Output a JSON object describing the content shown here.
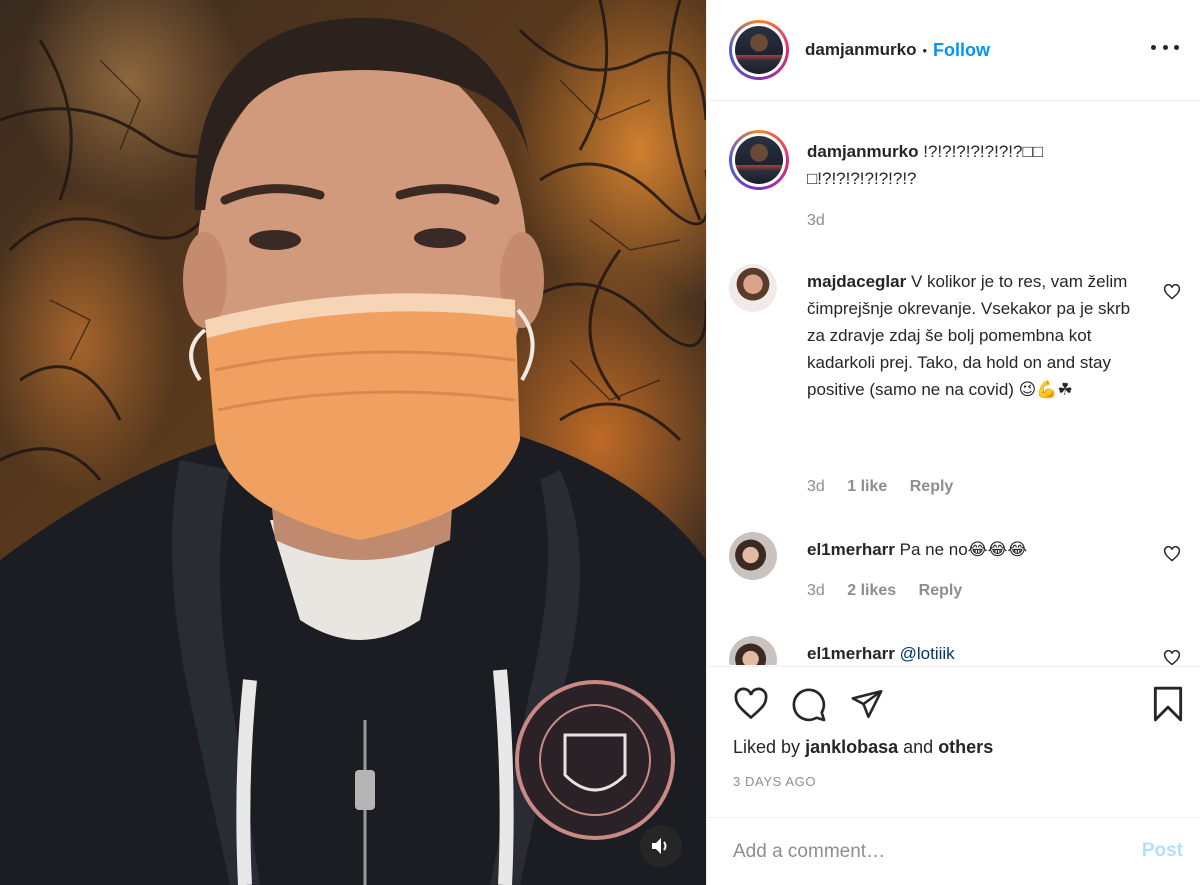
{
  "post": {
    "author": "damjanmurko",
    "follow_label": "Follow",
    "separator": "•",
    "caption": "!?!?!?!?!?!?!?□□ □!?!?!?!?!?!?!?",
    "caption_time": "3d"
  },
  "comments": [
    {
      "user": "majdaceglar",
      "text": "V kolikor je to res, vam želim čimprejšnje okrevanje. Vsekakor pa je skrb za zdravje zdaj še bolj pomembna kot kadarkoli prej. Tako, da hold on and stay positive (samo ne na covid) 😉💪☘",
      "time": "3d",
      "likes": "1 like",
      "reply_label": "Reply"
    },
    {
      "user": "el1merharr",
      "text": "Pa ne no😂😂😂",
      "time": "3d",
      "likes": "2 likes",
      "reply_label": "Reply"
    },
    {
      "user": "el1merharr",
      "mention": "@lotiiik"
    }
  ],
  "engagement": {
    "liked_prefix": "Liked by",
    "liked_user": "janklobasa",
    "liked_and": "and",
    "liked_others": "others",
    "date": "3 DAYS AGO"
  },
  "composer": {
    "placeholder": "Add a comment…",
    "post_label": "Post"
  },
  "icons": [
    "more-options-icon",
    "heart-icon",
    "comment-icon",
    "share-icon",
    "save-icon",
    "sound-icon"
  ],
  "colors": {
    "link": "#0095f6",
    "muted": "#8e8e8e",
    "post_disabled": "#b2dffc"
  }
}
